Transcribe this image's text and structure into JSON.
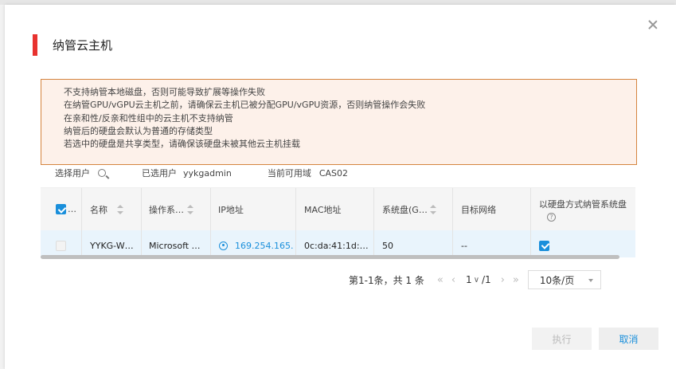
{
  "background": {
    "text_left": "",
    "text_right": ""
  },
  "dialog": {
    "title": "纳管云主机",
    "warnings": [
      "不支持纳管本地磁盘，否则可能导致扩展等操作失败",
      "在纳管GPU/vGPU云主机之前，请确保云主机已被分配GPU/vGPU资源，否则纳管操作会失败",
      "在亲和性/反亲和性组中的云主机不支持纳管",
      "纳管后的硬盘会默认为普通的存储类型",
      "若选中的硬盘是共享类型，请确保该硬盘未被其他云主机挂载"
    ],
    "filters": {
      "select_user_label": "选择用户",
      "selected_user_label": "已选用户",
      "selected_user_value": "yykgadmin",
      "domain_label": "当前可用域",
      "domain_value": "CAS02"
    },
    "table": {
      "headers": {
        "select": "…",
        "name": "名称",
        "os": "操作系…",
        "ip": "IP地址",
        "mac": "MAC地址",
        "sysdisk": "系统盘(G…",
        "network": "目标网络",
        "disk_mode": "以硬盘方式纳管系统盘"
      },
      "rows": [
        {
          "name": "YYKG-W…",
          "os": "Microsoft …",
          "ip": "169.254.165.",
          "mac": "0c:da:41:1d:…",
          "sysdisk": "50",
          "network": "--"
        }
      ]
    },
    "pagination": {
      "summary": "第1-1条，共 1 条",
      "current_page": "1",
      "total_pages": "/1",
      "page_size": "10条/页"
    },
    "buttons": {
      "execute": "执行",
      "cancel": "取消"
    },
    "colors": {
      "accent": "#1a8fdb",
      "title_bar": "#e8322f",
      "warning_border": "#d5843f",
      "warning_bg": "#fdf1ea"
    }
  }
}
